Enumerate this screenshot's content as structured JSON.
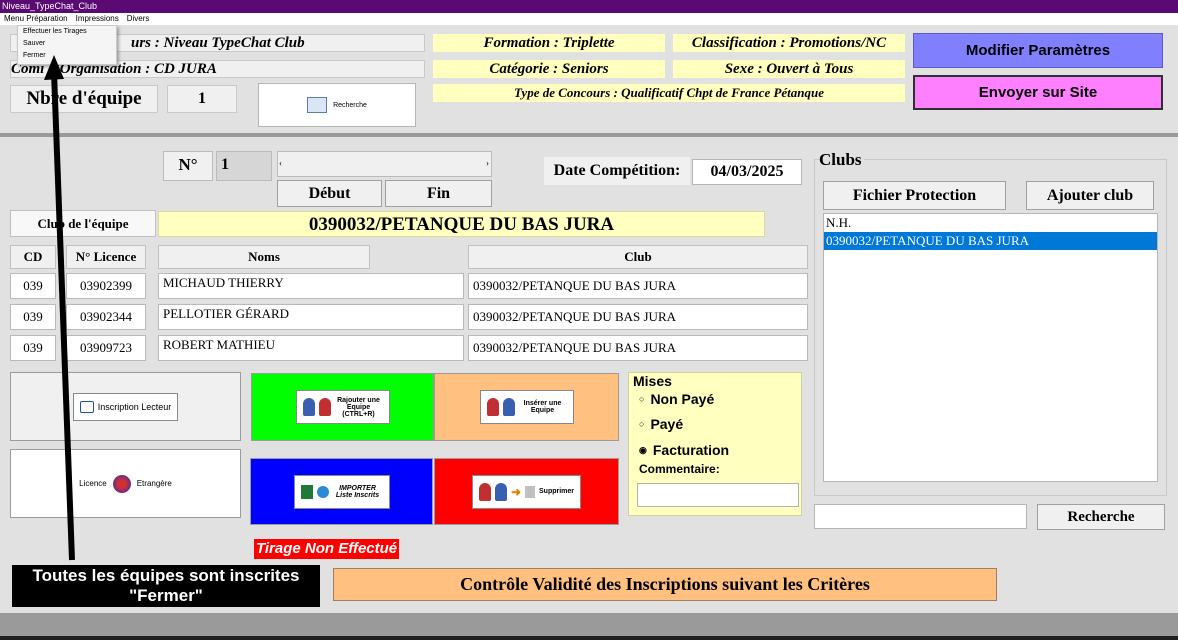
{
  "window": {
    "title": "Niveau_TypeChat_Club"
  },
  "menu": {
    "items": [
      "Menu Préparation",
      "Impressions",
      "Divers"
    ],
    "dropdown": [
      "Effectuer les Tirages",
      "Sauver",
      "Fermer"
    ]
  },
  "header": {
    "concours": "urs : Niveau  TypeChat  Club",
    "organisation": "Comi    d'Organisation : CD JURA",
    "formation": "Formation : Triplette",
    "categorie": "Catégorie : Seniors",
    "type_concours": "Type de Concours : Qualificatif Chpt de France Pétanque",
    "classification": "Classification : Promotions/NC",
    "sexe": "Sexe : Ouvert à Tous",
    "nbre_equipe_label": "Nbre d'équipe",
    "nbre_equipe_value": "1",
    "recherche_label": "Recherche",
    "modifier_label": "Modifier Paramètres",
    "envoyer_label": "Envoyer sur Site"
  },
  "nav": {
    "no_label": "N°",
    "no_value": "1",
    "debut_label": "Début",
    "fin_label": "Fin"
  },
  "date": {
    "label": "Date Compétition:",
    "value": "04/03/2025"
  },
  "club_equipe": {
    "label": "Club de l'équipe",
    "value": "0390032/PETANQUE DU BAS JURA"
  },
  "table": {
    "headers": {
      "cd": "CD",
      "licence": "N° Licence",
      "noms": "Noms",
      "club": "Club"
    },
    "rows": [
      {
        "cd": "039",
        "licence": "03902399",
        "nom": "MICHAUD THIERRY",
        "club": "0390032/PETANQUE DU BAS JURA"
      },
      {
        "cd": "039",
        "licence": "03902344",
        "nom": "PELLOTIER GÉRARD",
        "club": "0390032/PETANQUE DU BAS JURA"
      },
      {
        "cd": "039",
        "licence": "03909723",
        "nom": "ROBERT MATHIEU",
        "club": "0390032/PETANQUE DU BAS JURA"
      }
    ]
  },
  "actions": {
    "inscription_lecteur": "Inscription Lecteur",
    "licence": "Licence",
    "etrangere": "Etrangère",
    "rajouter": "Rajouter une Equipe (CTRL+R)",
    "inserer": "Insérer une Equipe",
    "importer": "IMPORTER Liste Inscrits",
    "supprimer": "Supprimer"
  },
  "mises": {
    "title": "Mises",
    "options": [
      "Non Payé",
      "Payé",
      "Facturation"
    ],
    "selected": "Facturation",
    "commentaire_label": "Commentaire:"
  },
  "clubs": {
    "title": "Clubs",
    "fichier_label": "Fichier Protection",
    "ajouter_label": "Ajouter club",
    "list": [
      "N.H.",
      "0390032/PETANQUE DU BAS JURA"
    ],
    "selected_index": 1,
    "recherche_label": "Recherche"
  },
  "tirage_status": "Tirage Non Effectué",
  "controle_label": "Contrôle Validité des Inscriptions suivant les Critères",
  "annotation": {
    "line1": "Toutes les équipes sont inscrites",
    "line2": "\"Fermer\""
  },
  "colors": {
    "titlebar": "#5b0a73",
    "modifier": "#8080ff",
    "envoyer": "#ff80ff",
    "green": "#00ff00",
    "peach": "#ffc080",
    "blue": "#0000ff",
    "red": "#ff0000",
    "selection": "#0078d7"
  }
}
